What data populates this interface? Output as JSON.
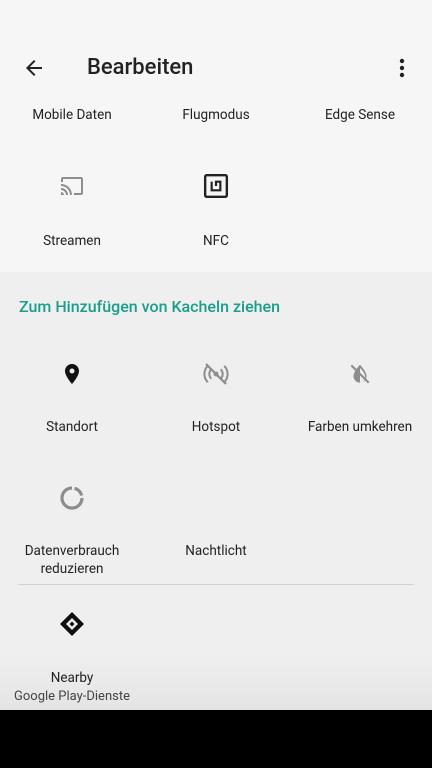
{
  "appbar": {
    "title": "Bearbeiten",
    "back_icon": "arrow-back-icon",
    "menu_icon": "more-vert-icon"
  },
  "active_tiles": [
    {
      "label": "Mobile Daten"
    },
    {
      "label": "Flugmodus"
    },
    {
      "label": "Edge Sense"
    },
    {
      "label": "Streamen",
      "icon": "cast-icon"
    },
    {
      "label": "NFC",
      "icon": "nfc-icon"
    }
  ],
  "add_section": {
    "header": "Zum Hinzufügen von Kacheln ziehen",
    "tiles": [
      {
        "label": "Standort",
        "icon": "location-pin-icon"
      },
      {
        "label": "Hotspot",
        "icon": "hotspot-off-icon"
      },
      {
        "label": "Farben umkehren",
        "icon": "invert-colors-off-icon"
      },
      {
        "label_line1": "Datenverbrauch",
        "label_line2": "reduzieren",
        "icon": "data-saver-icon"
      },
      {
        "label": "Nachtlicht",
        "icon": "moon-icon"
      }
    ],
    "third_party": [
      {
        "label": "Nearby",
        "sublabel": "Google Play-Dienste",
        "icon": "nearby-icon"
      }
    ]
  },
  "colors": {
    "accent": "#1a9d8a",
    "background": "#f6f6f6",
    "add_background": "#efefef",
    "navbar": "#000000"
  }
}
